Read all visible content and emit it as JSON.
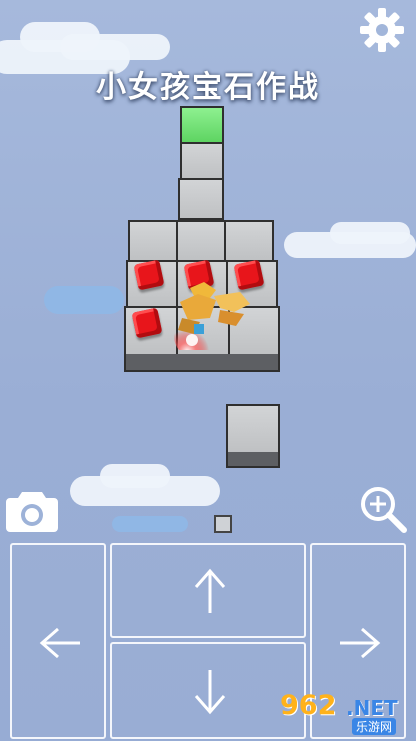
{
  "game": {
    "title": "小女孩宝石作战"
  },
  "icons": {
    "settings": "gear-icon",
    "camera": "camera-icon",
    "zoom": "zoom-in-icon",
    "up": "arrow-up-icon",
    "down": "arrow-down-icon",
    "left": "arrow-left-icon",
    "right": "arrow-right-icon"
  },
  "board": {
    "gems_visible": 4,
    "colors": {
      "tile": "#c8cacc",
      "goal": "#6fdc70",
      "gem": "#e8151b",
      "edge": "#2f2f2f"
    }
  },
  "watermark": {
    "number": "962",
    "suffix": ".NET",
    "site": "乐游网"
  }
}
